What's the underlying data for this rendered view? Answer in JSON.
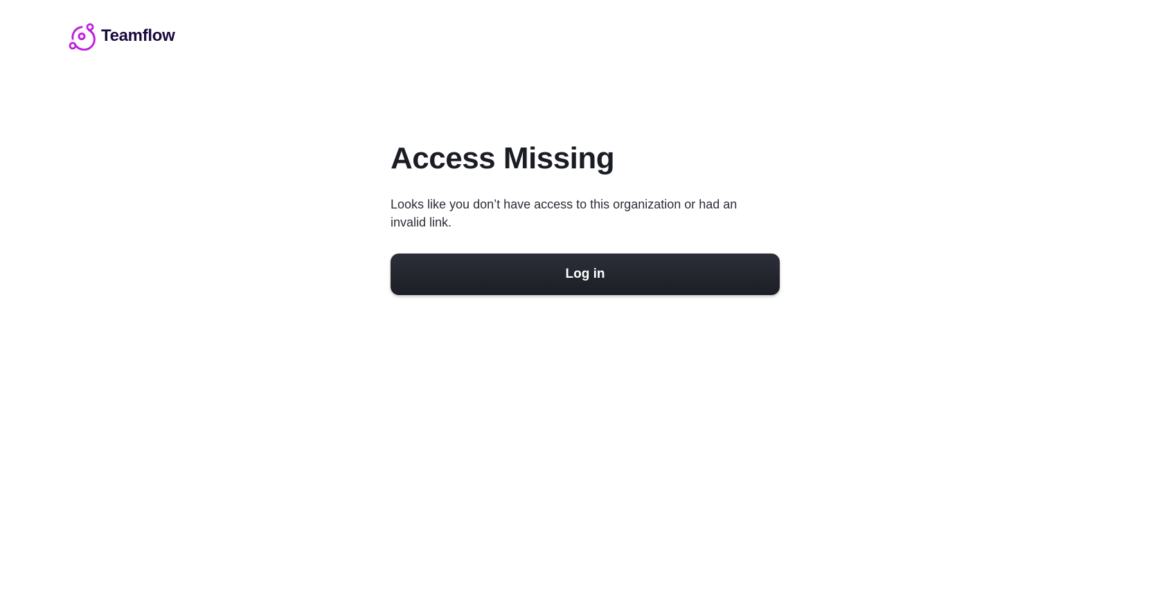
{
  "brand": {
    "name": "Teamflow",
    "logo_icon": "teamflow-orbit-logo",
    "logo_color": "#c01ee0",
    "name_color": "#1a0a3c"
  },
  "main": {
    "title": "Access Missing",
    "message": "Looks like you don’t have access to this organization or had an invalid link.",
    "login_button_label": "Log in",
    "button_color": "#22252d"
  }
}
